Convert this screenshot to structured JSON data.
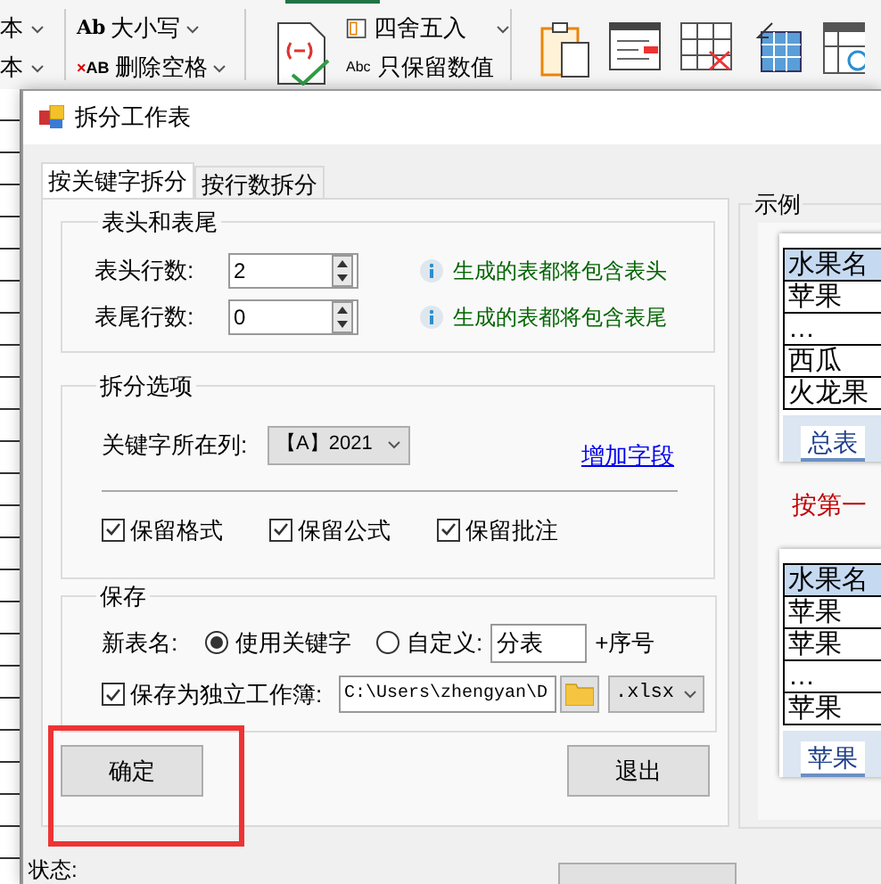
{
  "ribbon": {
    "font_items": [
      {
        "label": "本"
      },
      {
        "label": "本"
      }
    ],
    "text_tools": [
      {
        "kind": "case",
        "glyph": "Ab",
        "label": "大小写"
      },
      {
        "kind": "trim",
        "glyph_mark": "×",
        "glyph": "AB",
        "label": "删除空格"
      }
    ],
    "number_tools": [
      {
        "kind": "round",
        "label": "四舍五入"
      },
      {
        "kind": "values",
        "glyph": "Abc",
        "label": "只保留数值"
      }
    ]
  },
  "dialog": {
    "title": "拆分工作表",
    "tabs": [
      {
        "label": "按关键字拆分",
        "selected": true
      },
      {
        "label": "按行数拆分",
        "selected": false
      }
    ],
    "header_footer": {
      "title": "表头和表尾",
      "rows": [
        {
          "label": "表头行数:",
          "value": "2",
          "hint": "生成的表都将包含表头"
        },
        {
          "label": "表尾行数:",
          "value": "0",
          "hint": "生成的表都将包含表尾"
        }
      ]
    },
    "split_options": {
      "title": "拆分选项",
      "key_column_label": "关键字所在列:",
      "key_column_value": "【A】2021",
      "add_field_link": "增加字段",
      "checkboxes": [
        {
          "label": "保留格式",
          "checked": true
        },
        {
          "label": "保留公式",
          "checked": true
        },
        {
          "label": "保留批注",
          "checked": true
        }
      ]
    },
    "save": {
      "title": "保存",
      "sheet_name_label": "新表名:",
      "options": [
        {
          "label": "使用关键字",
          "selected": true
        },
        {
          "label": "自定义:",
          "selected": false
        }
      ],
      "custom_value": "分表",
      "suffix": "+序号",
      "workbook_label": "保存为独立工作簿:",
      "workbook_checked": true,
      "path": "C:\\Users\\zhengyan\\D",
      "format": ".xlsx"
    },
    "ok_button": "确定",
    "cancel_button": "退出",
    "example": {
      "title": "示例",
      "caption": "按第一",
      "sheets": [
        {
          "rows": [
            "水果名",
            "苹果",
            "…",
            "西瓜",
            "火龙果"
          ],
          "tab": "总表"
        },
        {
          "rows": [
            "水果名",
            "苹果",
            "苹果",
            "…",
            "苹果"
          ],
          "tab": "苹果"
        }
      ]
    },
    "status_label": "状态:"
  }
}
